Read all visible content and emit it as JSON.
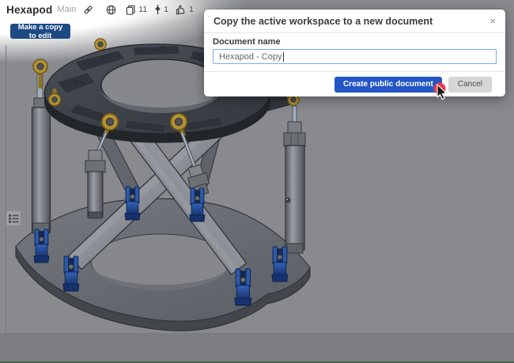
{
  "header": {
    "title": "Hexapod",
    "workspace": "Main",
    "make_copy_button": "Make a copy to edit",
    "stats": {
      "copies": "11",
      "forks": "1",
      "likes": "1"
    },
    "icons": [
      "link-icon",
      "globe-icon",
      "copies-icon",
      "fork-icon",
      "thumbs-up-icon"
    ]
  },
  "dialog": {
    "title": "Copy the active workspace to a new document",
    "close": "×",
    "document_name_label": "Document name",
    "document_name_value": "Hexapod - Copy",
    "create_button": "Create public document",
    "cancel_button": "Cancel"
  },
  "viewport": {
    "model": "hexapod-stewart-platform",
    "tool_icon": "feature-list-icon"
  },
  "colors": {
    "primary_blue": "#2355c5",
    "header_button_blue": "#1d4a83",
    "cursor_red": "#ee3b4b",
    "clamp_blue": "#2d5aa8",
    "gold": "#b3912f",
    "statusbar_green": "#44624b",
    "dim_background": "#898a8e"
  }
}
